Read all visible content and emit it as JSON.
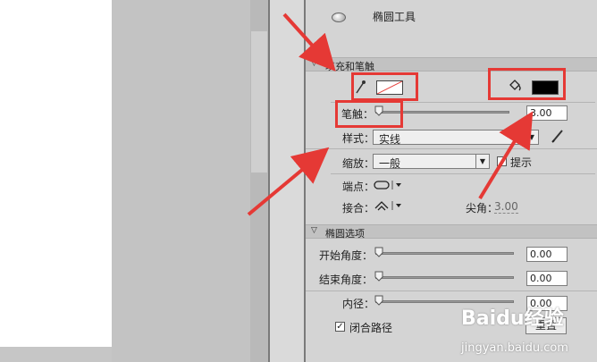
{
  "tool": {
    "title": "椭圆工具"
  },
  "fill_stroke": {
    "header": "填充和笔触",
    "stroke_label": "笔触：",
    "stroke_value": "3.00",
    "style_label": "样式：",
    "style_value": "实线",
    "scale_label": "缩放：",
    "scale_value": "一般",
    "hint_label": "提示",
    "cap_label": "端点：",
    "join_label": "接合：",
    "miter_label": "尖角：",
    "miter_value": "3.00"
  },
  "ellipse_options": {
    "header": "椭圆选项",
    "start_angle_label": "开始角度：",
    "start_angle_value": "0.00",
    "end_angle_label": "结束角度：",
    "end_angle_value": "0.00",
    "inner_radius_label": "内径：",
    "inner_radius_value": "0.00",
    "close_path_label": "闭合路径",
    "reset_label": "重置"
  },
  "watermark": {
    "brand": "Baidu经验",
    "url": "jingyan.baidu.com"
  },
  "colors": {
    "annotation": "#e53935",
    "fill_swatch": "#ffffff",
    "stroke_swatch": "#000000"
  }
}
